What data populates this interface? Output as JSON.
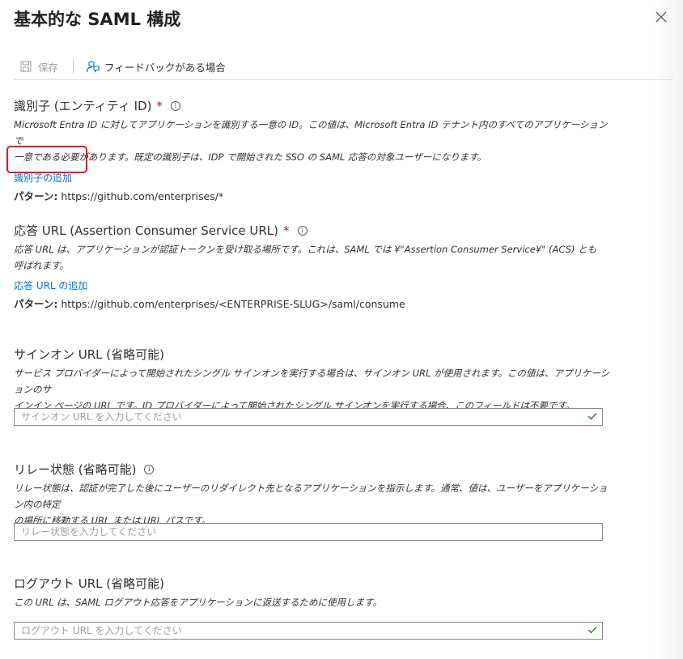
{
  "header": {
    "title": "基本的な SAML 構成",
    "close_icon": "close-icon"
  },
  "toolbar": {
    "save_label": "保存",
    "feedback_label": "フィードバックがある場合"
  },
  "identifier": {
    "heading": "識別子 (エンティティ ID)",
    "required": "*",
    "desc_line1": "Microsoft Entra ID に対してアプリケーションを識別する一意の ID。この値は、Microsoft Entra ID テナント内のすべてのアプリケーションで",
    "desc_line2": "一意である必要があります。既定の識別子は、IDP で開始された SSO の SAML 応答の対象ユーザーになります。",
    "add_link": "識別子の追加",
    "pattern_label": "パターン:",
    "pattern_value": "https://github.com/enterprises/*"
  },
  "reply_url": {
    "heading": "応答 URL (Assertion Consumer Service URL)",
    "required": "*",
    "desc_line1": "応答 URL は、アプリケーションが認証トークンを受け取る場所です。これは、SAML では ¥\"Assertion Consumer Service¥\" (ACS) とも",
    "desc_line2": "呼ばれます。",
    "add_link": "応答 URL の追加",
    "pattern_label": "パターン:",
    "pattern_value": "https://github.com/enterprises/<ENTERPRISE-SLUG>/saml/consume"
  },
  "sign_on": {
    "heading": "サインオン URL (省略可能)",
    "desc_line1": "サービス プロバイダーによって開始されたシングル サインオンを実行する場合は、サインオン URL が使用されます。この値は、アプリケーションのサ",
    "desc_line2": "インイン ページの URL です。ID プロバイダーによって開始されたシングル サインオンを実行する場合、このフィールドは不要です。",
    "placeholder": "サインオン URL を入力してください"
  },
  "relay_state": {
    "heading": "リレー状態 (省略可能)",
    "desc_line1": "リレー状態は、認証が完了した後にユーザーのリダイレクト先となるアプリケーションを指示します。通常、値は、ユーザーをアプリケーション内の特定",
    "desc_line2": "の場所に移動する URL または URL パスです。",
    "placeholder": "リレー状態を入力してください"
  },
  "logout": {
    "heading": "ログアウト URL (省略可能)",
    "desc_line1": "この URL は、SAML ログアウト応答をアプリケーションに返送するために使用します。",
    "placeholder": "ログアウト URL を入力してください"
  },
  "colors": {
    "link": "#0078d4",
    "required": "#a4262c",
    "check": "#107c10",
    "highlight": "#e81123"
  }
}
